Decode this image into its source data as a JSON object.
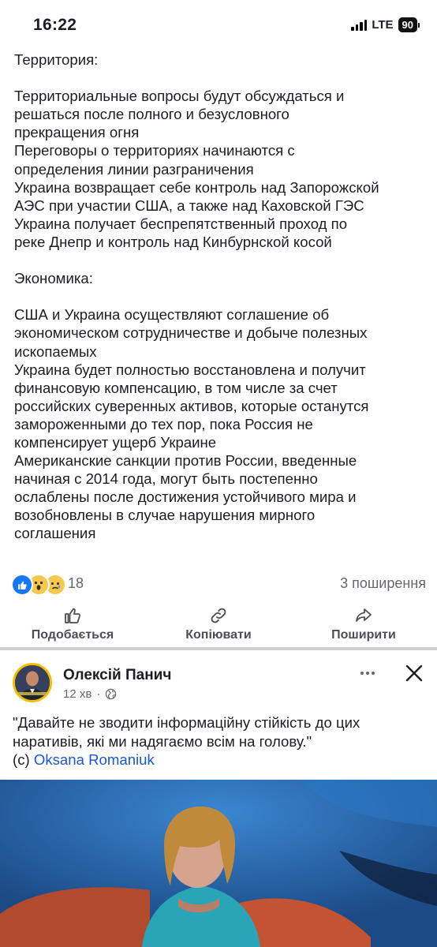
{
  "status_bar": {
    "time": "16:22",
    "network": "LTE",
    "battery": "90"
  },
  "post": {
    "body_lines": [
      "Территория:",
      "",
      "Территориальные вопросы будут обсуждаться и",
      "решаться после полного и безусловного",
      "прекращения огня",
      "Переговоры о территориях начинаются с",
      "определения линии разграничения",
      "Украина возвращает себе контроль над Запорожской",
      "АЭС при участии США, а также над Каховской ГЭС",
      "Украина получает беспрепятственный проход по",
      "реке Днепр и контроль над Кинбурнской косой",
      "",
      "Экономика:",
      "",
      "США и Украина осуществляют соглашение об",
      "экономическом сотрудничестве и добыче полезных",
      "ископаемых",
      "Украина будет полностью восстановлена и получит",
      "финансовую компенсацию, в том числе за счет",
      "российских суверенных активов, которые останутся",
      "замороженными до тех пор, пока Россия не",
      "компенсирует ущерб Украине",
      "Американские санкции против России, введенные",
      "начиная с 2014 года, могут быть постепенно",
      "ослаблены после достижения устойчивого мира и",
      "возобновлены в случае нарушения мирного",
      "соглашения"
    ],
    "reaction_icons": [
      "like-icon",
      "wow-icon",
      "sad-icon"
    ],
    "reaction_count": "18",
    "shares": "3 поширення",
    "actions": {
      "like": "Подобається",
      "copy": "Копіювати",
      "share": "Поширити"
    }
  },
  "next_post": {
    "author": "Олексій Панич",
    "time": "12 хв",
    "audience_icon": "globe-icon",
    "quote_lines": [
      "\"Давайте не зводити інформаційну стійкість до цих",
      "наративів, які ми надягаємо всім на голову.\""
    ],
    "credit_prefix": "(c) ",
    "credit_name": "Oksana Romaniuk"
  },
  "colors": {
    "accent": "#1877f2",
    "link": "#1a56d6",
    "text": "#1c1e21",
    "secondary": "#65676b"
  }
}
